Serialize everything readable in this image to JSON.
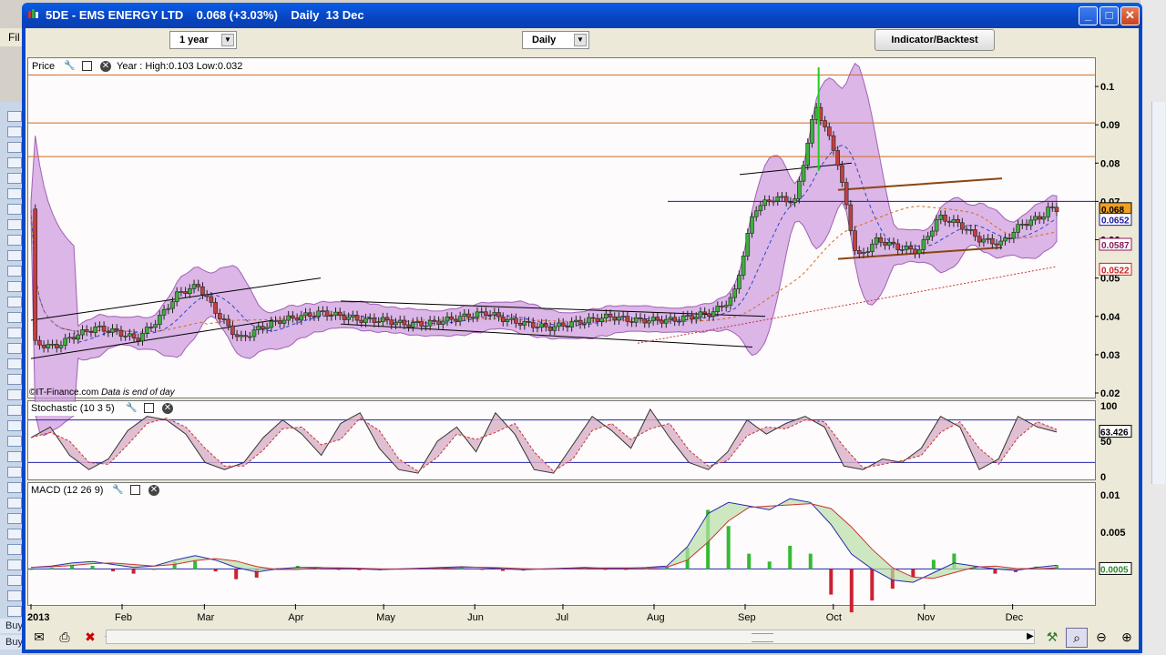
{
  "window": {
    "title": "5DE - EMS ENERGY LTD    0.068 (+3.03%)    Daily  13 Dec",
    "minimize": "_",
    "maximize": "□",
    "close": "✕"
  },
  "app_menu": {
    "file_stub": "Fil"
  },
  "toolbar": {
    "period": "1 year",
    "interval": "Daily",
    "indicator_button": "Indicator/Backtest"
  },
  "price_pane": {
    "label": "Price",
    "year_info": "Year : High:0.103 Low:0.032",
    "credit_source": "©IT-Finance.com",
    "credit_note": "Data is end of day",
    "value_boxes": [
      "0.068",
      "0.0652",
      "0.0587",
      "0.0522"
    ]
  },
  "stoch_pane": {
    "label": "Stochastic (10 3 5)",
    "value_box": "63.426"
  },
  "macd_pane": {
    "label": "MACD (12 26 9)",
    "value_box": "0.0005"
  },
  "left_list": {
    "buy1": "Buy",
    "buy2": "Buy"
  },
  "chart_data": [
    {
      "type": "line",
      "title": "Price",
      "x_ticks": [
        "2013",
        "Feb",
        "Mar",
        "Apr",
        "May",
        "Jun",
        "Jul",
        "Aug",
        "Sep",
        "Oct",
        "Nov",
        "Dec"
      ],
      "y_ticks": [
        0.02,
        0.03,
        0.04,
        "0.05",
        0.06,
        "0.07",
        0.08,
        0.09,
        0.1
      ],
      "ylim": [
        0.02,
        0.105
      ],
      "series": [
        {
          "x": [
            "2013-01-02",
            "2013-01-09",
            "2013-01-16",
            "2013-01-23",
            "2013-01-30",
            "2013-02-06",
            "2013-02-13",
            "2013-02-20",
            "2013-02-27",
            "2013-03-06",
            "2013-03-13",
            "2013-03-20",
            "2013-03-27",
            "2013-04-03",
            "2013-04-10",
            "2013-04-17",
            "2013-04-24",
            "2013-05-01",
            "2013-05-08",
            "2013-05-15",
            "2013-05-22",
            "2013-05-29",
            "2013-06-05",
            "2013-06-12",
            "2013-06-19",
            "2013-06-26",
            "2013-07-03",
            "2013-07-10",
            "2013-07-17",
            "2013-07-24",
            "2013-07-31",
            "2013-08-07",
            "2013-08-14",
            "2013-08-21",
            "2013-08-28",
            "2013-09-04",
            "2013-09-11",
            "2013-09-18",
            "2013-09-25",
            "2013-10-02",
            "2013-10-09",
            "2013-10-16",
            "2013-10-23",
            "2013-10-30",
            "2013-11-06",
            "2013-11-13",
            "2013-11-20",
            "2013-11-27",
            "2013-12-04",
            "2013-12-11",
            "2013-12-13"
          ],
          "values": [
            0.033,
            0.032,
            0.035,
            0.037,
            0.036,
            0.034,
            0.039,
            0.046,
            0.048,
            0.04,
            0.034,
            0.037,
            0.039,
            0.04,
            0.041,
            0.04,
            0.039,
            0.039,
            0.038,
            0.038,
            0.039,
            0.04,
            0.041,
            0.039,
            0.038,
            0.037,
            0.038,
            0.039,
            0.04,
            0.039,
            0.039,
            0.039,
            0.04,
            0.041,
            0.045,
            0.068,
            0.071,
            0.07,
            0.095,
            0.082,
            0.055,
            0.06,
            0.058,
            0.057,
            0.066,
            0.064,
            0.06,
            0.059,
            0.064,
            0.066,
            0.068
          ]
        }
      ],
      "horizontal_levels": [
        0.103,
        0.0905,
        0.0817,
        0.07
      ],
      "legend": "none",
      "grid": false
    },
    {
      "type": "line",
      "title": "Stochastic (10 3 5)",
      "y_ticks": [
        0,
        50,
        100
      ],
      "ylim": [
        0,
        100
      ],
      "reference_lines": [
        20,
        80
      ],
      "series": [
        {
          "values": [
            55,
            70,
            30,
            10,
            25,
            65,
            85,
            80,
            60,
            20,
            10,
            20,
            55,
            80,
            60,
            30,
            75,
            90,
            40,
            10,
            5,
            50,
            70,
            35,
            90,
            60,
            10,
            5,
            45,
            85,
            65,
            40,
            95,
            55,
            20,
            10,
            35,
            80,
            60,
            75,
            85,
            70,
            15,
            10,
            25,
            20,
            40,
            85,
            70,
            10,
            25,
            85,
            70,
            63
          ]
        }
      ],
      "legend": "none",
      "grid": false
    },
    {
      "type": "line",
      "title": "MACD (12 26 9)",
      "y_ticks": [
        0,
        0.005,
        0.01
      ],
      "ylim": [
        -0.0045,
        0.011
      ],
      "series": [
        {
          "values": [
            0.0002,
            0.0004,
            0.0008,
            0.001,
            0.0006,
            0.0002,
            0.0004,
            0.0012,
            0.0018,
            0.0012,
            0.0002,
            -0.0004,
            0.0,
            0.0002,
            0.0002,
            0.0001,
            0.0,
            -0.0001,
            0.0,
            0.0001,
            0.0002,
            0.0003,
            0.0002,
            0.0,
            -0.0001,
            0.0,
            0.0001,
            0.0002,
            0.0001,
            0.0001,
            0.0002,
            0.0004,
            0.003,
            0.0075,
            0.009,
            0.0085,
            0.008,
            0.0095,
            0.009,
            0.006,
            0.002,
            0.0,
            -0.0015,
            -0.0018,
            -0.0005,
            0.0008,
            0.0004,
            0.0,
            -0.0002,
            0.0002,
            0.0005
          ]
        }
      ],
      "legend": "none",
      "grid": false
    }
  ],
  "colors": {
    "bollinger_fill": "#cc99dd",
    "candle_up": "#3fae3f",
    "candle_down": "#c04040",
    "level_line": "#d2691e",
    "resistance": "#1a1aa0",
    "channel": "#8b4513",
    "window_blue": "#0a5ee8"
  }
}
